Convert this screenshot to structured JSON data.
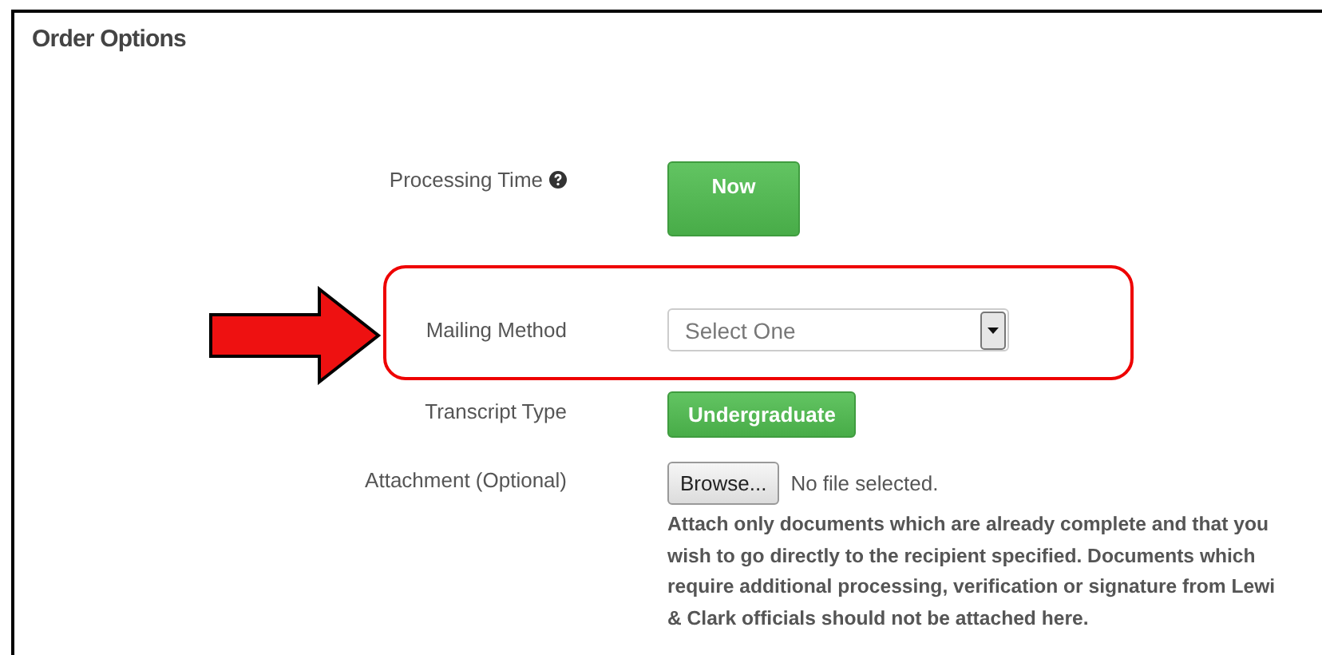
{
  "section": {
    "title": "Order Options"
  },
  "fields": [
    {
      "kind": "button",
      "label": "Processing Time",
      "help": true,
      "value": "Now"
    },
    {
      "kind": "select",
      "label": "Mailing Method",
      "help": false,
      "value": "Select One",
      "highlighted": true
    },
    {
      "kind": "pill",
      "label": "Transcript Type",
      "help": false,
      "value": "Undergraduate"
    },
    {
      "kind": "file",
      "label": "Attachment (Optional)",
      "help": false,
      "button": "Browse...",
      "value": "No file selected.",
      "note_lines": [
        "Attach only documents which are already complete and that you",
        "wish to go directly to the recipient specified. Documents which",
        "require additional processing, verification or signature from Lewi",
        "& Clark officials should not be attached here."
      ]
    }
  ]
}
